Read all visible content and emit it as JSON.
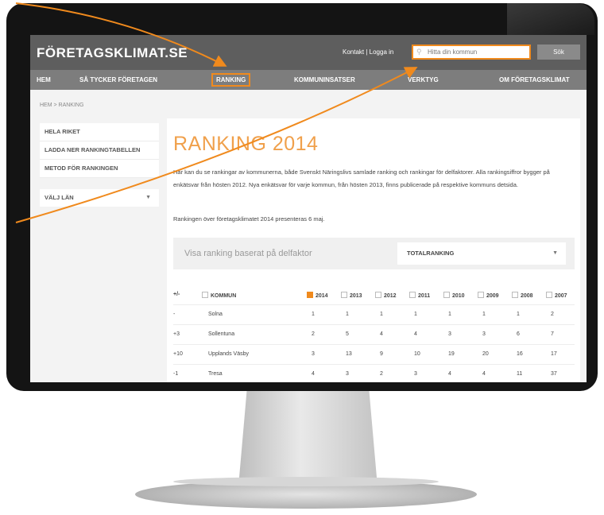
{
  "header": {
    "logo": "FÖRETAGSKLIMAT.SE",
    "links": "Kontakt | Logga in",
    "search_placeholder": "Hitta din kommun",
    "search_button": "Sök"
  },
  "nav": {
    "items": [
      "HEM",
      "SÅ TYCKER FÖRETAGEN",
      "RANKING",
      "KOMMUNINSATSER",
      "VERKTYG",
      "OM FÖRETAGSKLIMAT"
    ]
  },
  "breadcrumb": "HEM  >  RANKING",
  "sidebar": {
    "items": [
      "HELA RIKET",
      "LADDA NER RANKINGTABELLEN",
      "METOD FÖR RANKINGEN"
    ],
    "select_label": "VÄLJ LÄN"
  },
  "main": {
    "title": "RANKING 2014",
    "intro": "Här kan du se rankingar av kommunerna, både Svenskt Näringslivs samlade ranking och rankingar för delfaktorer. Alla rankingsiffror bygger på enkätsvar från hösten 2012. Nya enkätsvar för varje kommun, från hösten 2013, finns publicerade på respektive kommuns detsida.",
    "note": "Rankingen över företagsklimatet 2014 presenteras 6 maj.",
    "filter_label": "Visa ranking baserat på delfaktor",
    "filter_value": "TOTALRANKING"
  },
  "table": {
    "headers": [
      "+/-",
      "KOMMUN",
      "2014",
      "2013",
      "2012",
      "2011",
      "2010",
      "2009",
      "2008",
      "2007"
    ],
    "rows": [
      [
        "-",
        "Solna",
        "1",
        "1",
        "1",
        "1",
        "1",
        "1",
        "1",
        "2"
      ],
      [
        "+3",
        "Sollentuna",
        "2",
        "5",
        "4",
        "4",
        "3",
        "3",
        "6",
        "7"
      ],
      [
        "+10",
        "Upplands Väsby",
        "3",
        "13",
        "9",
        "10",
        "19",
        "20",
        "16",
        "17"
      ],
      [
        "-1",
        "Tresa",
        "4",
        "3",
        "2",
        "3",
        "4",
        "4",
        "11",
        "37"
      ]
    ]
  },
  "colors": {
    "accent": "#f08a1d",
    "header_bg": "#5e5e5e",
    "nav_bg": "#7d7d7d",
    "title": "#f0a04b"
  }
}
